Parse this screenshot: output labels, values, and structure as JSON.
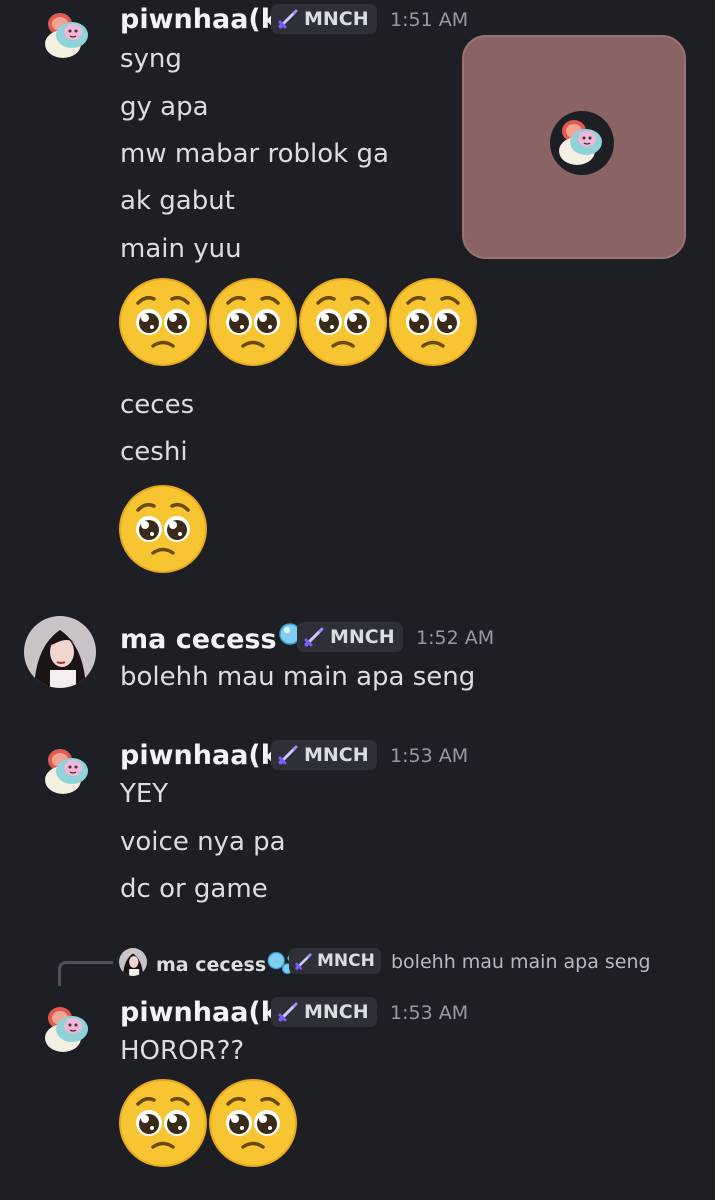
{
  "colors": {
    "background": "#1e1f24",
    "tag_bg": "#2e3037",
    "embed_bg": "#8a6364",
    "emoji_yellow": "#f7c531"
  },
  "icons": {
    "server_tag": "sword-icon",
    "bubbles": "bubbles-emoji-icon"
  },
  "messages": [
    {
      "username": "piwnhaa(k)",
      "tag": "MNCH",
      "time": "1:51 AM",
      "lines": [
        "syng",
        "gy apa",
        "mw mabar roblok ga",
        "ak gabut",
        "main yuu"
      ],
      "emoji_count": 4,
      "lines_after": [
        "ceces",
        "ceshi"
      ],
      "emoji_count_after": 1
    },
    {
      "username": "ma cecess",
      "tag": "MNCH",
      "time": "1:52 AM",
      "lines": [
        "bolehh mau main apa seng"
      ]
    },
    {
      "username": "piwnhaa(k)",
      "tag": "MNCH",
      "time": "1:53 AM",
      "lines": [
        "YEY",
        "voice nya pa",
        "dc or game"
      ]
    },
    {
      "reply": {
        "username": "ma cecess",
        "tag": "MNCH",
        "text": "bolehh mau main apa seng"
      },
      "username": "piwnhaa(k)",
      "tag": "MNCH",
      "time": "1:53 AM",
      "lines": [
        "HOROR??"
      ],
      "emoji_count": 2
    }
  ]
}
